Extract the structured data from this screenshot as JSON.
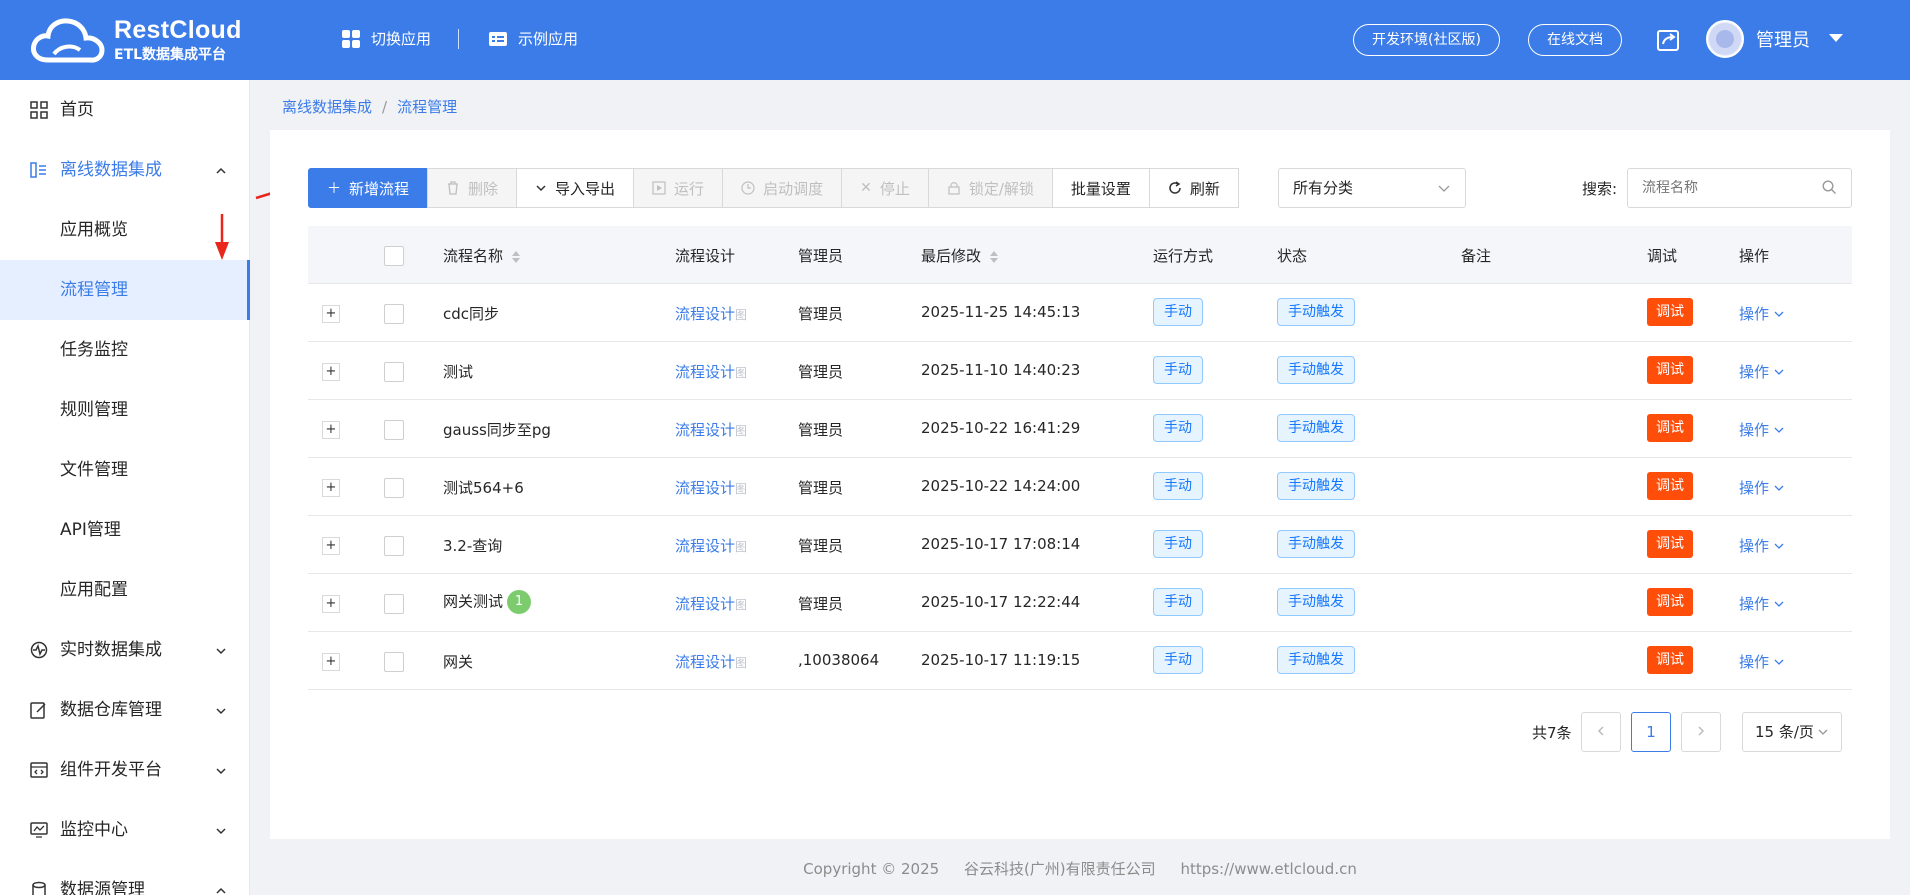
{
  "header": {
    "logo_title": "RestCloud",
    "logo_subtitle": "ETL数据集成平台",
    "switch_app": "切换应用",
    "example_app": "示例应用",
    "env": "开发环境(社区版)",
    "docs": "在线文档",
    "user": "管理员"
  },
  "sidebar": {
    "items": [
      {
        "label": "首页"
      },
      {
        "label": "离线数据集成"
      },
      {
        "label": "应用概览"
      },
      {
        "label": "流程管理"
      },
      {
        "label": "任务监控"
      },
      {
        "label": "规则管理"
      },
      {
        "label": "文件管理"
      },
      {
        "label": "API管理"
      },
      {
        "label": "应用配置"
      },
      {
        "label": "实时数据集成"
      },
      {
        "label": "数据仓库管理"
      },
      {
        "label": "组件开发平台"
      },
      {
        "label": "监控中心"
      },
      {
        "label": "数据源管理"
      }
    ]
  },
  "breadcrumb": {
    "parent": "离线数据集成",
    "sep": "/",
    "current": "流程管理"
  },
  "toolbar": {
    "add": "新增流程",
    "delete": "删除",
    "import_export": "导入导出",
    "run": "运行",
    "start_schedule": "启动调度",
    "stop": "停止",
    "lock": "锁定/解锁",
    "batch": "批量设置",
    "refresh": "刷新",
    "category": "所有分类",
    "search_label": "搜索:",
    "search_placeholder": "流程名称"
  },
  "table": {
    "headers": {
      "name": "流程名称",
      "design": "流程设计",
      "admin": "管理员",
      "modified": "最后修改",
      "mode": "运行方式",
      "status": "状态",
      "remark": "备注",
      "debug": "调试",
      "action": "操作"
    },
    "rows": [
      {
        "name": "cdc同步",
        "design": "流程设计",
        "design_tail": "图",
        "admin": "管理员",
        "modified": "2025-11-25 14:45:13",
        "mode": "手动",
        "status": "手动触发",
        "debug": "调试",
        "action": "操作",
        "badge": ""
      },
      {
        "name": "测试",
        "design": "流程设计",
        "design_tail": "图",
        "admin": "管理员",
        "modified": "2025-11-10 14:40:23",
        "mode": "手动",
        "status": "手动触发",
        "debug": "调试",
        "action": "操作",
        "badge": ""
      },
      {
        "name": "gauss同步至pg",
        "design": "流程设计",
        "design_tail": "图",
        "admin": "管理员",
        "modified": "2025-10-22 16:41:29",
        "mode": "手动",
        "status": "手动触发",
        "debug": "调试",
        "action": "操作",
        "badge": ""
      },
      {
        "name": "测试564+6",
        "design": "流程设计",
        "design_tail": "图",
        "admin": "管理员",
        "modified": "2025-10-22 14:24:00",
        "mode": "手动",
        "status": "手动触发",
        "debug": "调试",
        "action": "操作",
        "badge": ""
      },
      {
        "name": "3.2-查询",
        "design": "流程设计",
        "design_tail": "图",
        "admin": "管理员",
        "modified": "2025-10-17 17:08:14",
        "mode": "手动",
        "status": "手动触发",
        "debug": "调试",
        "action": "操作",
        "badge": ""
      },
      {
        "name": "网关测试",
        "design": "流程设计",
        "design_tail": "图",
        "admin": "管理员",
        "modified": "2025-10-17 12:22:44",
        "mode": "手动",
        "status": "手动触发",
        "debug": "调试",
        "action": "操作",
        "badge": "1"
      },
      {
        "name": "网关",
        "design": "流程设计",
        "design_tail": "图",
        "admin": ",10038064",
        "modified": "2025-10-17 11:19:15",
        "mode": "手动",
        "status": "手动触发",
        "debug": "调试",
        "action": "操作",
        "badge": ""
      }
    ]
  },
  "pagination": {
    "total": "共7条",
    "current": "1",
    "page_size": "15 条/页"
  },
  "footer": {
    "copyright": "Copyright © 2025",
    "company": "谷云科技(广州)有限责任公司",
    "url": "https://www.etlcloud.cn"
  }
}
